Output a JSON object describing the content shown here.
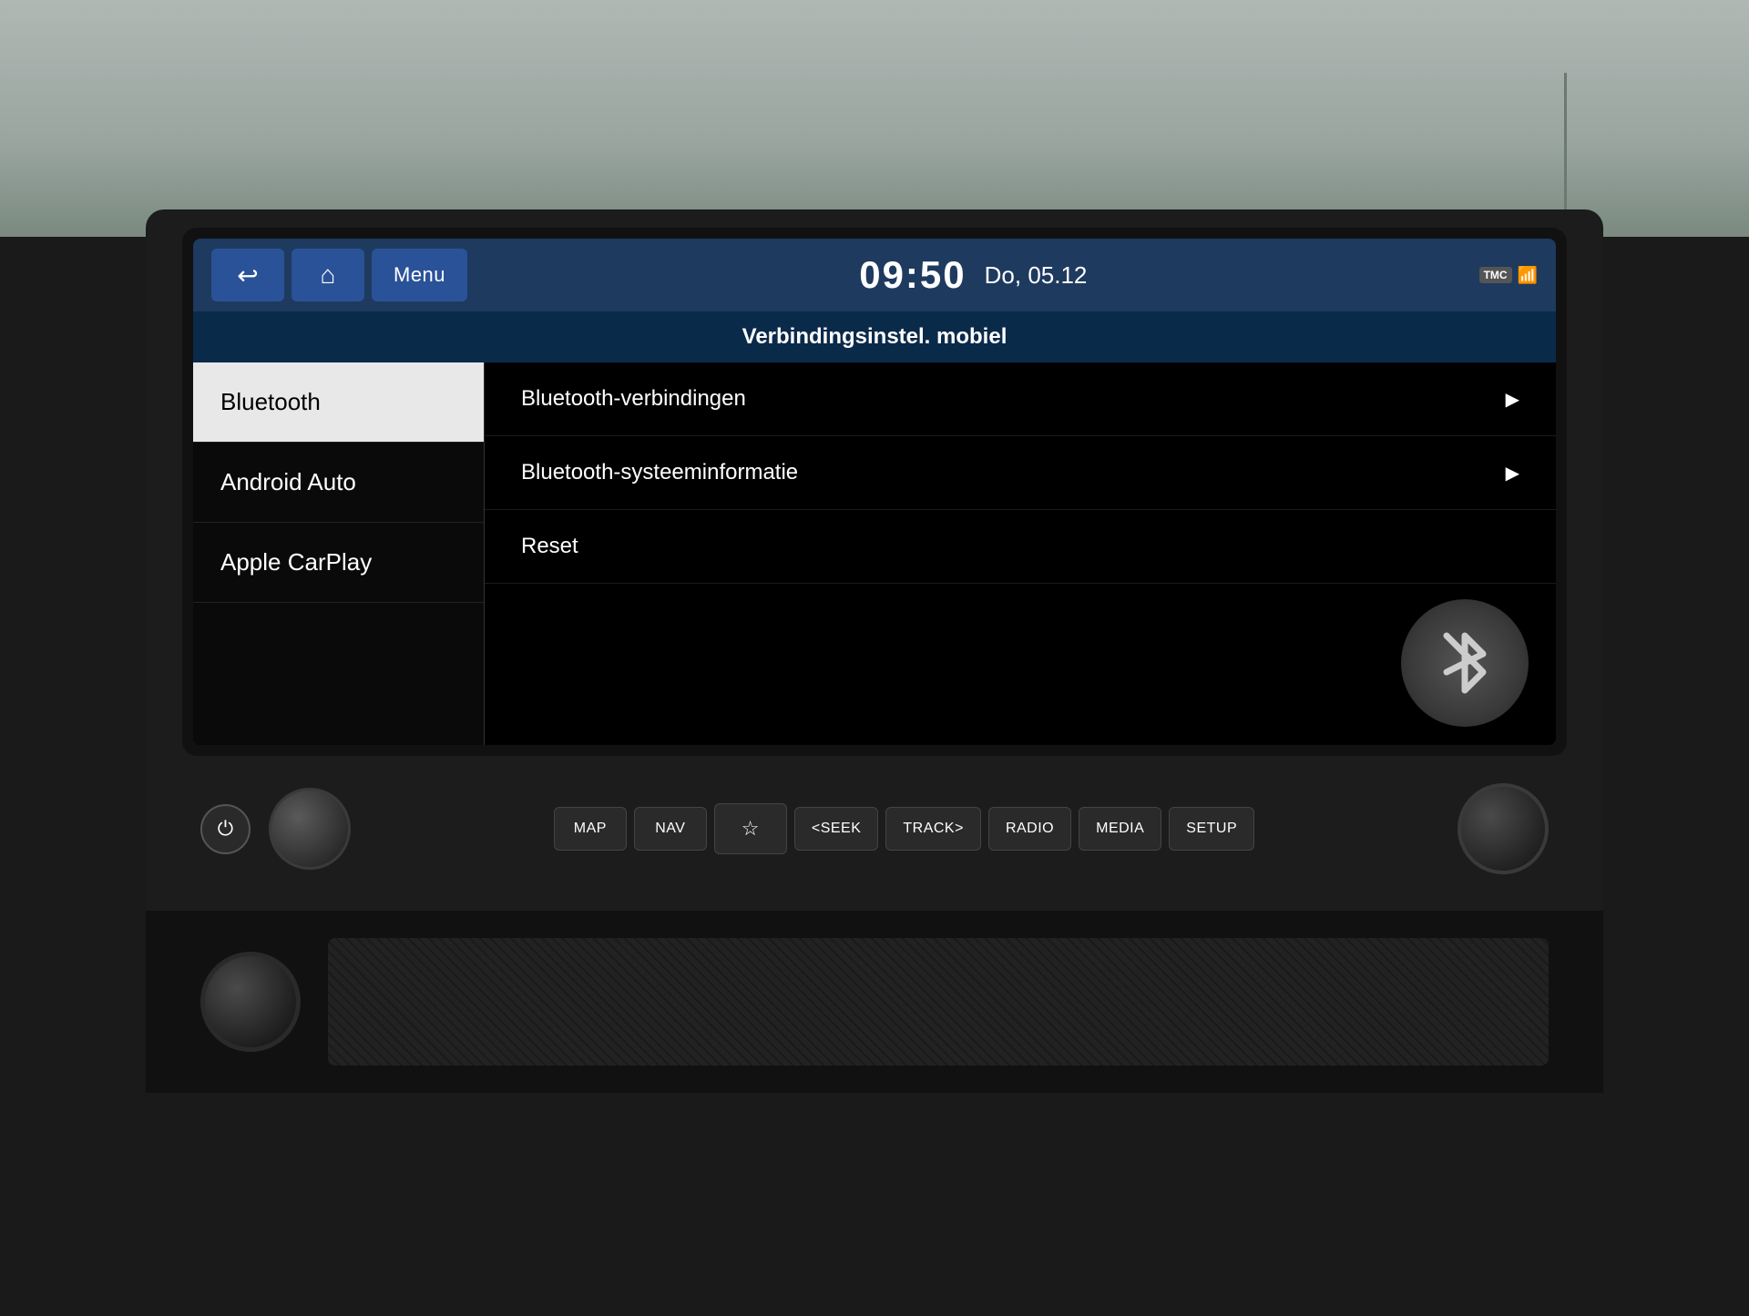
{
  "background": {
    "color": "#b0b8b4"
  },
  "header": {
    "back_btn": "↩",
    "home_btn": "⌂",
    "menu_label": "Menu",
    "clock": "09:50",
    "date": "Do, 05.12",
    "tmc": "TMC",
    "signal": "📶"
  },
  "page_title": "Verbindingsinstel. mobiel",
  "sidebar": {
    "items": [
      {
        "label": "Bluetooth",
        "active": true
      },
      {
        "label": "Android Auto",
        "active": false
      },
      {
        "label": "Apple CarPlay",
        "active": false
      }
    ]
  },
  "menu_items": [
    {
      "label": "Bluetooth-verbindingen",
      "has_arrow": true
    },
    {
      "label": "Bluetooth-systeeminformatie",
      "has_arrow": true
    },
    {
      "label": "Reset",
      "has_arrow": false
    }
  ],
  "bluetooth_icon": "✱",
  "physical_buttons": {
    "power": "⏻",
    "buttons": [
      {
        "label": "MAP"
      },
      {
        "label": "NAV"
      },
      {
        "label": "☆"
      },
      {
        "label": "<SEEK"
      },
      {
        "label": "TRACK>"
      },
      {
        "label": "RADIO"
      },
      {
        "label": "MEDIA"
      },
      {
        "label": "SETUP"
      }
    ]
  }
}
